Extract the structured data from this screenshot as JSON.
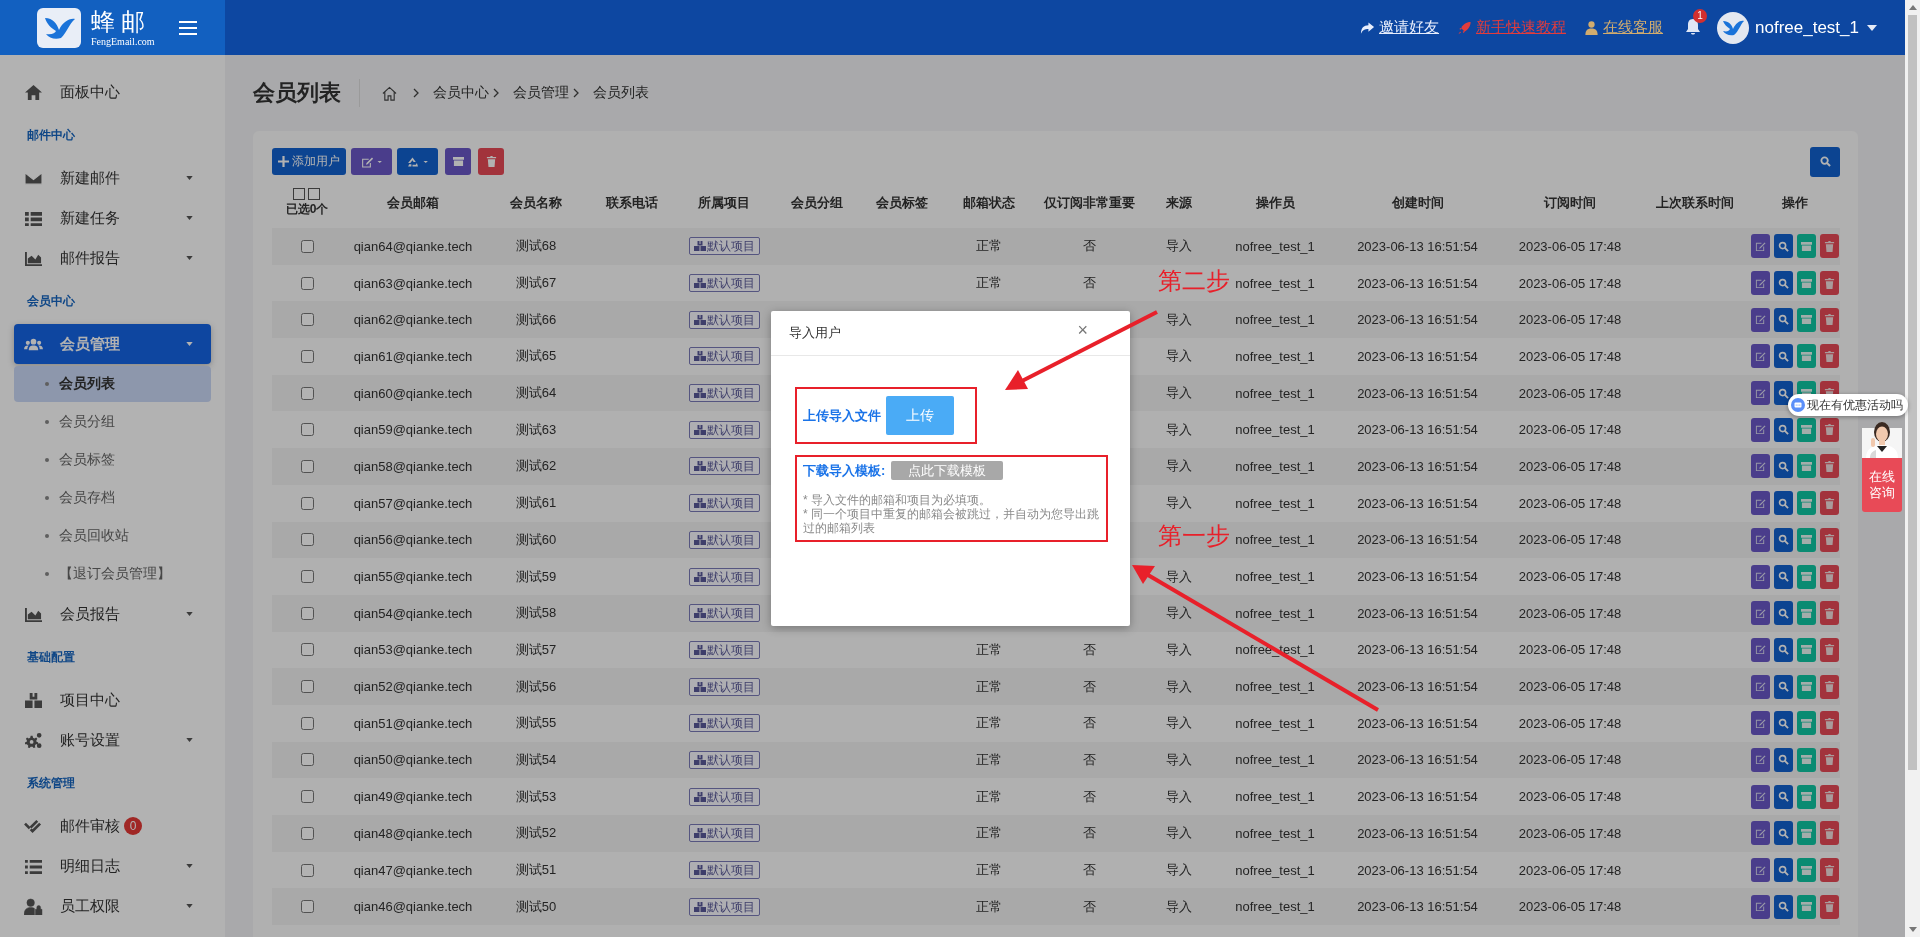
{
  "header": {
    "logo_text": "蜂邮",
    "logo_sub": "FengEmail.com",
    "links": [
      {
        "kind": "invite",
        "label": "邀请好友"
      },
      {
        "kind": "tutorial",
        "label": "新手快速教程"
      },
      {
        "kind": "service",
        "label": "在线客服"
      }
    ],
    "notification_count": "1",
    "username": "nofree_test_1"
  },
  "sidebar": {
    "items": [
      {
        "kind": "item",
        "label": "面板中心",
        "caret": false,
        "selected": false
      },
      {
        "kind": "section",
        "label": "邮件中心"
      },
      {
        "kind": "item",
        "label": "新建邮件",
        "caret": true,
        "selected": false
      },
      {
        "kind": "item",
        "label": "新建任务",
        "caret": true,
        "selected": false
      },
      {
        "kind": "item",
        "label": "邮件报告",
        "caret": true,
        "selected": false
      },
      {
        "kind": "section",
        "label": "会员中心"
      },
      {
        "kind": "item",
        "label": "会员管理",
        "caret": true,
        "selected": true
      },
      {
        "kind": "subitem",
        "label": "会员列表",
        "selected": true
      },
      {
        "kind": "subitem",
        "label": "会员分组",
        "selected": false
      },
      {
        "kind": "subitem",
        "label": "会员标签",
        "selected": false
      },
      {
        "kind": "subitem",
        "label": "会员存档",
        "selected": false
      },
      {
        "kind": "subitem",
        "label": "会员回收站",
        "selected": false
      },
      {
        "kind": "subitem",
        "label": "【退订会员管理】",
        "selected": false
      },
      {
        "kind": "item",
        "label": "会员报告",
        "caret": true,
        "selected": false
      },
      {
        "kind": "section",
        "label": "基础配置"
      },
      {
        "kind": "item",
        "label": "项目中心",
        "caret": false,
        "selected": false
      },
      {
        "kind": "item",
        "label": "账号设置",
        "caret": true,
        "selected": false
      },
      {
        "kind": "section",
        "label": "系统管理"
      },
      {
        "kind": "item",
        "label": "邮件审核",
        "caret": false,
        "selected": false,
        "badge": "0"
      },
      {
        "kind": "item",
        "label": "明细日志",
        "caret": true,
        "selected": false
      },
      {
        "kind": "item",
        "label": "员工权限",
        "caret": true,
        "selected": false
      }
    ]
  },
  "page_title": "会员列表",
  "breadcrumb": [
    "会员中心",
    "会员管理",
    "会员列表"
  ],
  "toolbar": {
    "add_button": "添加用户"
  },
  "table": {
    "selected_count": "已选**0**个",
    "columns": [
      "会员邮箱",
      "会员名称",
      "联系电话",
      "所属项目",
      "会员分组",
      "会员标签",
      "邮箱状态",
      "仅订阅非常重要",
      "来源",
      "操作员",
      "创建时间",
      "订阅时间",
      "上次联系时间",
      "操作"
    ],
    "rows": [
      {
        "checked": false,
        "email": "qian64@qianke.tech",
        "name": "测试68",
        "project": "默认项目",
        "status": "正常",
        "important": "否",
        "source": "导入",
        "operator": "nofree_test_1",
        "created": "2023-06-13 16:51:54",
        "subscribed": "2023-06-05 17:48"
      },
      {
        "checked": false,
        "email": "qian63@qianke.tech",
        "name": "测试67",
        "project": "默认项目",
        "status": "正常",
        "important": "否",
        "operator": "nofree_test_1",
        "created": "2023-06-13 16:51:54",
        "subscribed": "2023-06-05 17:48"
      },
      {
        "checked": false,
        "email": "qian62@qianke.tech",
        "name": "测试66",
        "project": "默认项目",
        "source": "导入",
        "operator": "nofree_test_1",
        "created": "2023-06-13 16:51:54",
        "subscribed": "2023-06-05 17:48"
      },
      {
        "checked": false,
        "email": "qian61@qianke.tech",
        "name": "测试65",
        "project": "默认项目",
        "source": "导入",
        "operator": "nofree_test_1",
        "created": "2023-06-13 16:51:54",
        "subscribed": "2023-06-05 17:48"
      },
      {
        "checked": false,
        "email": "qian60@qianke.tech",
        "name": "测试64",
        "project": "默认项目",
        "source": "导入",
        "operator": "nofree_test_1",
        "created": "2023-06-13 16:51:54",
        "subscribed": "2023-06-05 17:48"
      },
      {
        "checked": false,
        "email": "qian59@qianke.tech",
        "name": "测试63",
        "project": "默认项目",
        "source": "导入",
        "operator": "nofree_test_1",
        "created": "2023-06-13 16:51:54",
        "subscribed": "2023-06-05 17:48"
      },
      {
        "checked": false,
        "email": "qian58@qianke.tech",
        "name": "测试62",
        "project": "默认项目",
        "source": "导入",
        "operator": "nofree_test_1",
        "created": "2023-06-13 16:51:54",
        "subscribed": "2023-06-05 17:48"
      },
      {
        "checked": false,
        "email": "qian57@qianke.tech",
        "name": "测试61",
        "project": "默认项目",
        "source": "导入",
        "operator": "nofree_test_1",
        "created": "2023-06-13 16:51:54",
        "subscribed": "2023-06-05 17:48"
      },
      {
        "checked": false,
        "email": "qian56@qianke.tech",
        "name": "测试60",
        "project": "默认项目",
        "operator": "nofree_test_1",
        "created": "2023-06-13 16:51:54",
        "subscribed": "2023-06-05 17:48"
      },
      {
        "checked": false,
        "email": "qian55@qianke.tech",
        "name": "测试59",
        "project": "默认项目",
        "source": "导入",
        "operator": "nofree_test_1",
        "created": "2023-06-13 16:51:54",
        "subscribed": "2023-06-05 17:48"
      },
      {
        "checked": false,
        "email": "qian54@qianke.tech",
        "name": "测试58",
        "project": "默认项目",
        "source": "导入",
        "operator": "nofree_test_1",
        "created": "2023-06-13 16:51:54",
        "subscribed": "2023-06-05 17:48"
      },
      {
        "checked": false,
        "email": "qian53@qianke.tech",
        "name": "测试57",
        "project": "默认项目",
        "status": "正常",
        "important": "否",
        "source": "导入",
        "operator": "nofree_test_1",
        "created": "2023-06-13 16:51:54",
        "subscribed": "2023-06-05 17:48"
      },
      {
        "checked": false,
        "email": "qian52@qianke.tech",
        "name": "测试56",
        "project": "默认项目",
        "status": "正常",
        "important": "否",
        "source": "导入",
        "operator": "nofree_test_1",
        "created": "2023-06-13 16:51:54",
        "subscribed": "2023-06-05 17:48"
      },
      {
        "checked": false,
        "email": "qian51@qianke.tech",
        "name": "测试55",
        "project": "默认项目",
        "status": "正常",
        "important": "否",
        "source": "导入",
        "operator": "nofree_test_1",
        "created": "2023-06-13 16:51:54",
        "subscribed": "2023-06-05 17:48"
      },
      {
        "checked": false,
        "email": "qian50@qianke.tech",
        "name": "测试54",
        "project": "默认项目",
        "status": "正常",
        "important": "否",
        "source": "导入",
        "operator": "nofree_test_1",
        "created": "2023-06-13 16:51:54",
        "subscribed": "2023-06-05 17:48"
      },
      {
        "checked": false,
        "email": "qian49@qianke.tech",
        "name": "测试53",
        "project": "默认项目",
        "status": "正常",
        "important": "否",
        "source": "导入",
        "operator": "nofree_test_1",
        "created": "2023-06-13 16:51:54",
        "subscribed": "2023-06-05 17:48"
      },
      {
        "checked": false,
        "email": "qian48@qianke.tech",
        "name": "测试52",
        "project": "默认项目",
        "status": "正常",
        "important": "否",
        "source": "导入",
        "operator": "nofree_test_1",
        "created": "2023-06-13 16:51:54",
        "subscribed": "2023-06-05 17:48"
      },
      {
        "checked": false,
        "email": "qian47@qianke.tech",
        "name": "测试51",
        "project": "默认项目",
        "status": "正常",
        "important": "否",
        "source": "导入",
        "operator": "nofree_test_1",
        "created": "2023-06-13 16:51:54",
        "subscribed": "2023-06-05 17:48"
      },
      {
        "checked": false,
        "email": "qian46@qianke.tech",
        "name": "测试50",
        "project": "默认项目",
        "status": "正常",
        "important": "否",
        "source": "导入",
        "operator": "nofree_test_1",
        "created": "2023-06-13 16:51:54",
        "subscribed": "2023-06-05 17:48"
      }
    ]
  },
  "modal": {
    "title": "导入用户",
    "close": "×",
    "upload_label": "上传导入文件",
    "upload_button": "上传",
    "template_label": "下载导入模板:",
    "template_button": "点此下载模板",
    "notes": [
      "* 导入文件的邮箱和项目为必填项。",
      "* 同一个项目中重复的邮箱会被跳过，并自动为您导出跳过的邮箱列表"
    ]
  },
  "annotations": [
    "第二步",
    "第一步"
  ],
  "chat_widget": {
    "bubble": "现在有优惠活动吗",
    "button": "在线咨询"
  }
}
